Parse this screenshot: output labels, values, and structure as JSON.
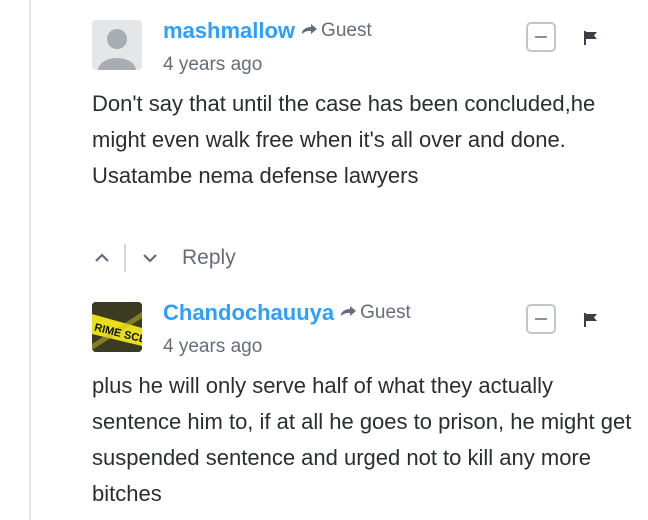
{
  "comments": [
    {
      "author": "mashmallow",
      "guest_label": "Guest",
      "time": "4 years ago",
      "text": "Don't say that until the case has been concluded,he might even walk free when it's all over and done. Usatambe nema defense lawyers",
      "reply_label": "Reply",
      "avatar_icon": "default-avatar-icon"
    },
    {
      "author": "Chandochauuya",
      "guest_label": "Guest",
      "time": "4 years ago",
      "text": "plus he will only serve half of what they actually sentence him to, if at all he goes to prison, he might get suspended sentence and urged not to kill any more bitches",
      "avatar_icon": "crime-scene-tape-avatar",
      "avatar_text": "RIME SCENE"
    }
  ],
  "colors": {
    "author": "#2e9fff",
    "meta": "#656c7a",
    "body": "#2a2e2e",
    "thread_line": "#e3e6e8"
  }
}
